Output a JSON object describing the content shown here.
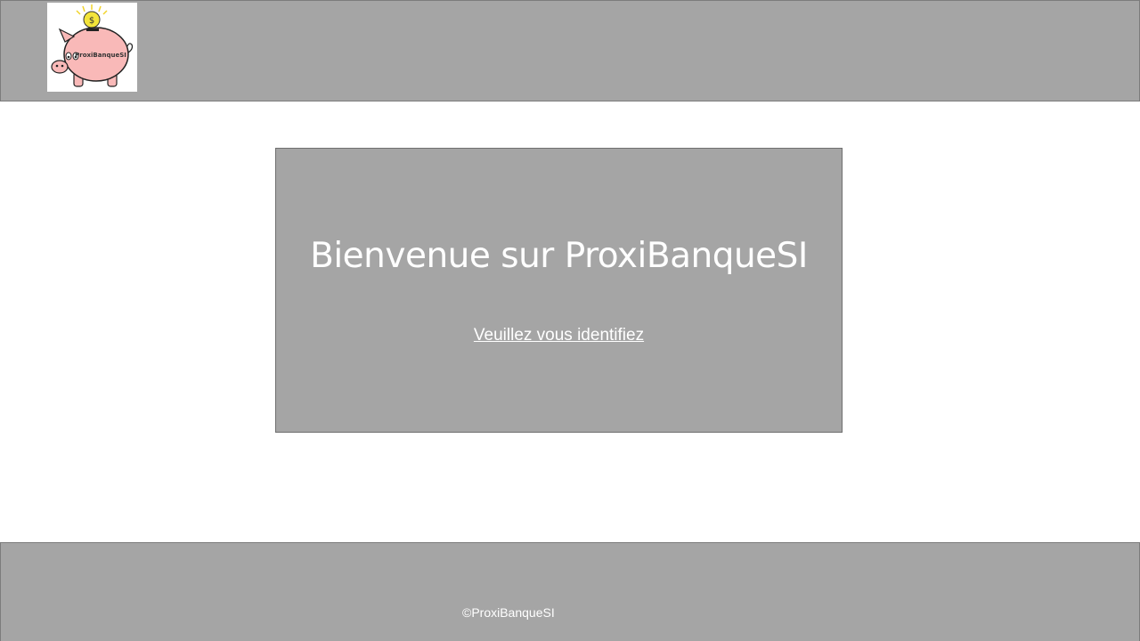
{
  "header": {
    "logo": {
      "icon": "piggy-bank-logo",
      "text": "ProxiBanqueSI"
    }
  },
  "main": {
    "title": "Bienvenue sur ProxiBanqueSI",
    "login_link": "Veuillez vous identifiez"
  },
  "footer": {
    "copyright": "©ProxiBanqueSI"
  },
  "colors": {
    "panel_gray": "#a5a5a5",
    "border_gray": "#7c7c7c",
    "text_white": "#ffffff",
    "piggy_pink": "#f9b9b8",
    "coin_yellow": "#f3e43a"
  }
}
